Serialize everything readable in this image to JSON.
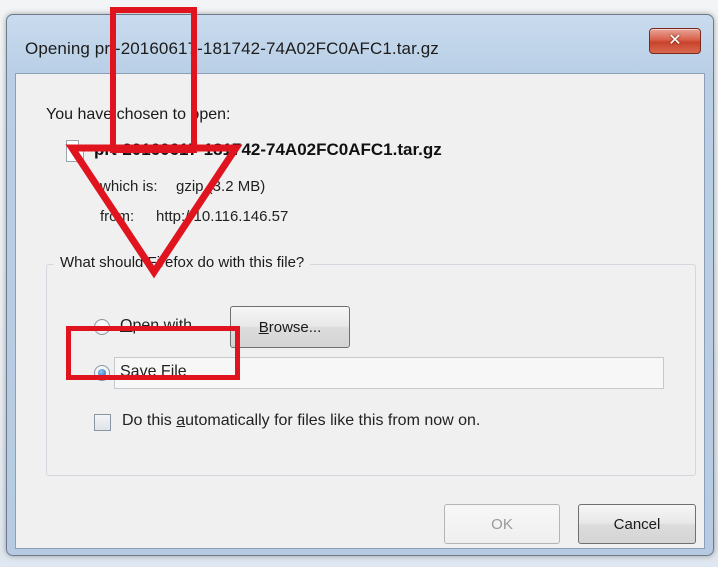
{
  "window": {
    "title": "Opening prt-20160617-181742-74A02FC0AFC1.tar.gz",
    "close_glyph": "✕"
  },
  "dialog": {
    "chosen_text": "You have chosen to open:",
    "file_name": "prt-20160617-181742-74A02FC0AFC1.tar.gz",
    "which_is_label": "which is:",
    "which_is_value": "gzip (3.2 MB)",
    "from_label": "from:",
    "from_value": "http://10.116.146.57",
    "question": "What should Firefox do with this file?",
    "open_with_prefix": "",
    "open_with_accel": "O",
    "open_with_rest": "pen with",
    "browse_accel": "B",
    "browse_rest": "rowse...",
    "save_accel": "S",
    "save_rest": "ave File",
    "auto_prefix": "Do this ",
    "auto_accel": "a",
    "auto_rest": "utomatically for files like this from now on.",
    "ok_label": "OK",
    "cancel_label": "Cancel",
    "selected_action": "save"
  },
  "annotation": {
    "color": "#e0141e",
    "arrow_icon": "down-arrow-icon"
  },
  "colors": {
    "titlebar": "#c9dbee",
    "client": "#f0f0f0",
    "close_button": "#d8604a",
    "radio_selected": "#1f5fa8"
  }
}
